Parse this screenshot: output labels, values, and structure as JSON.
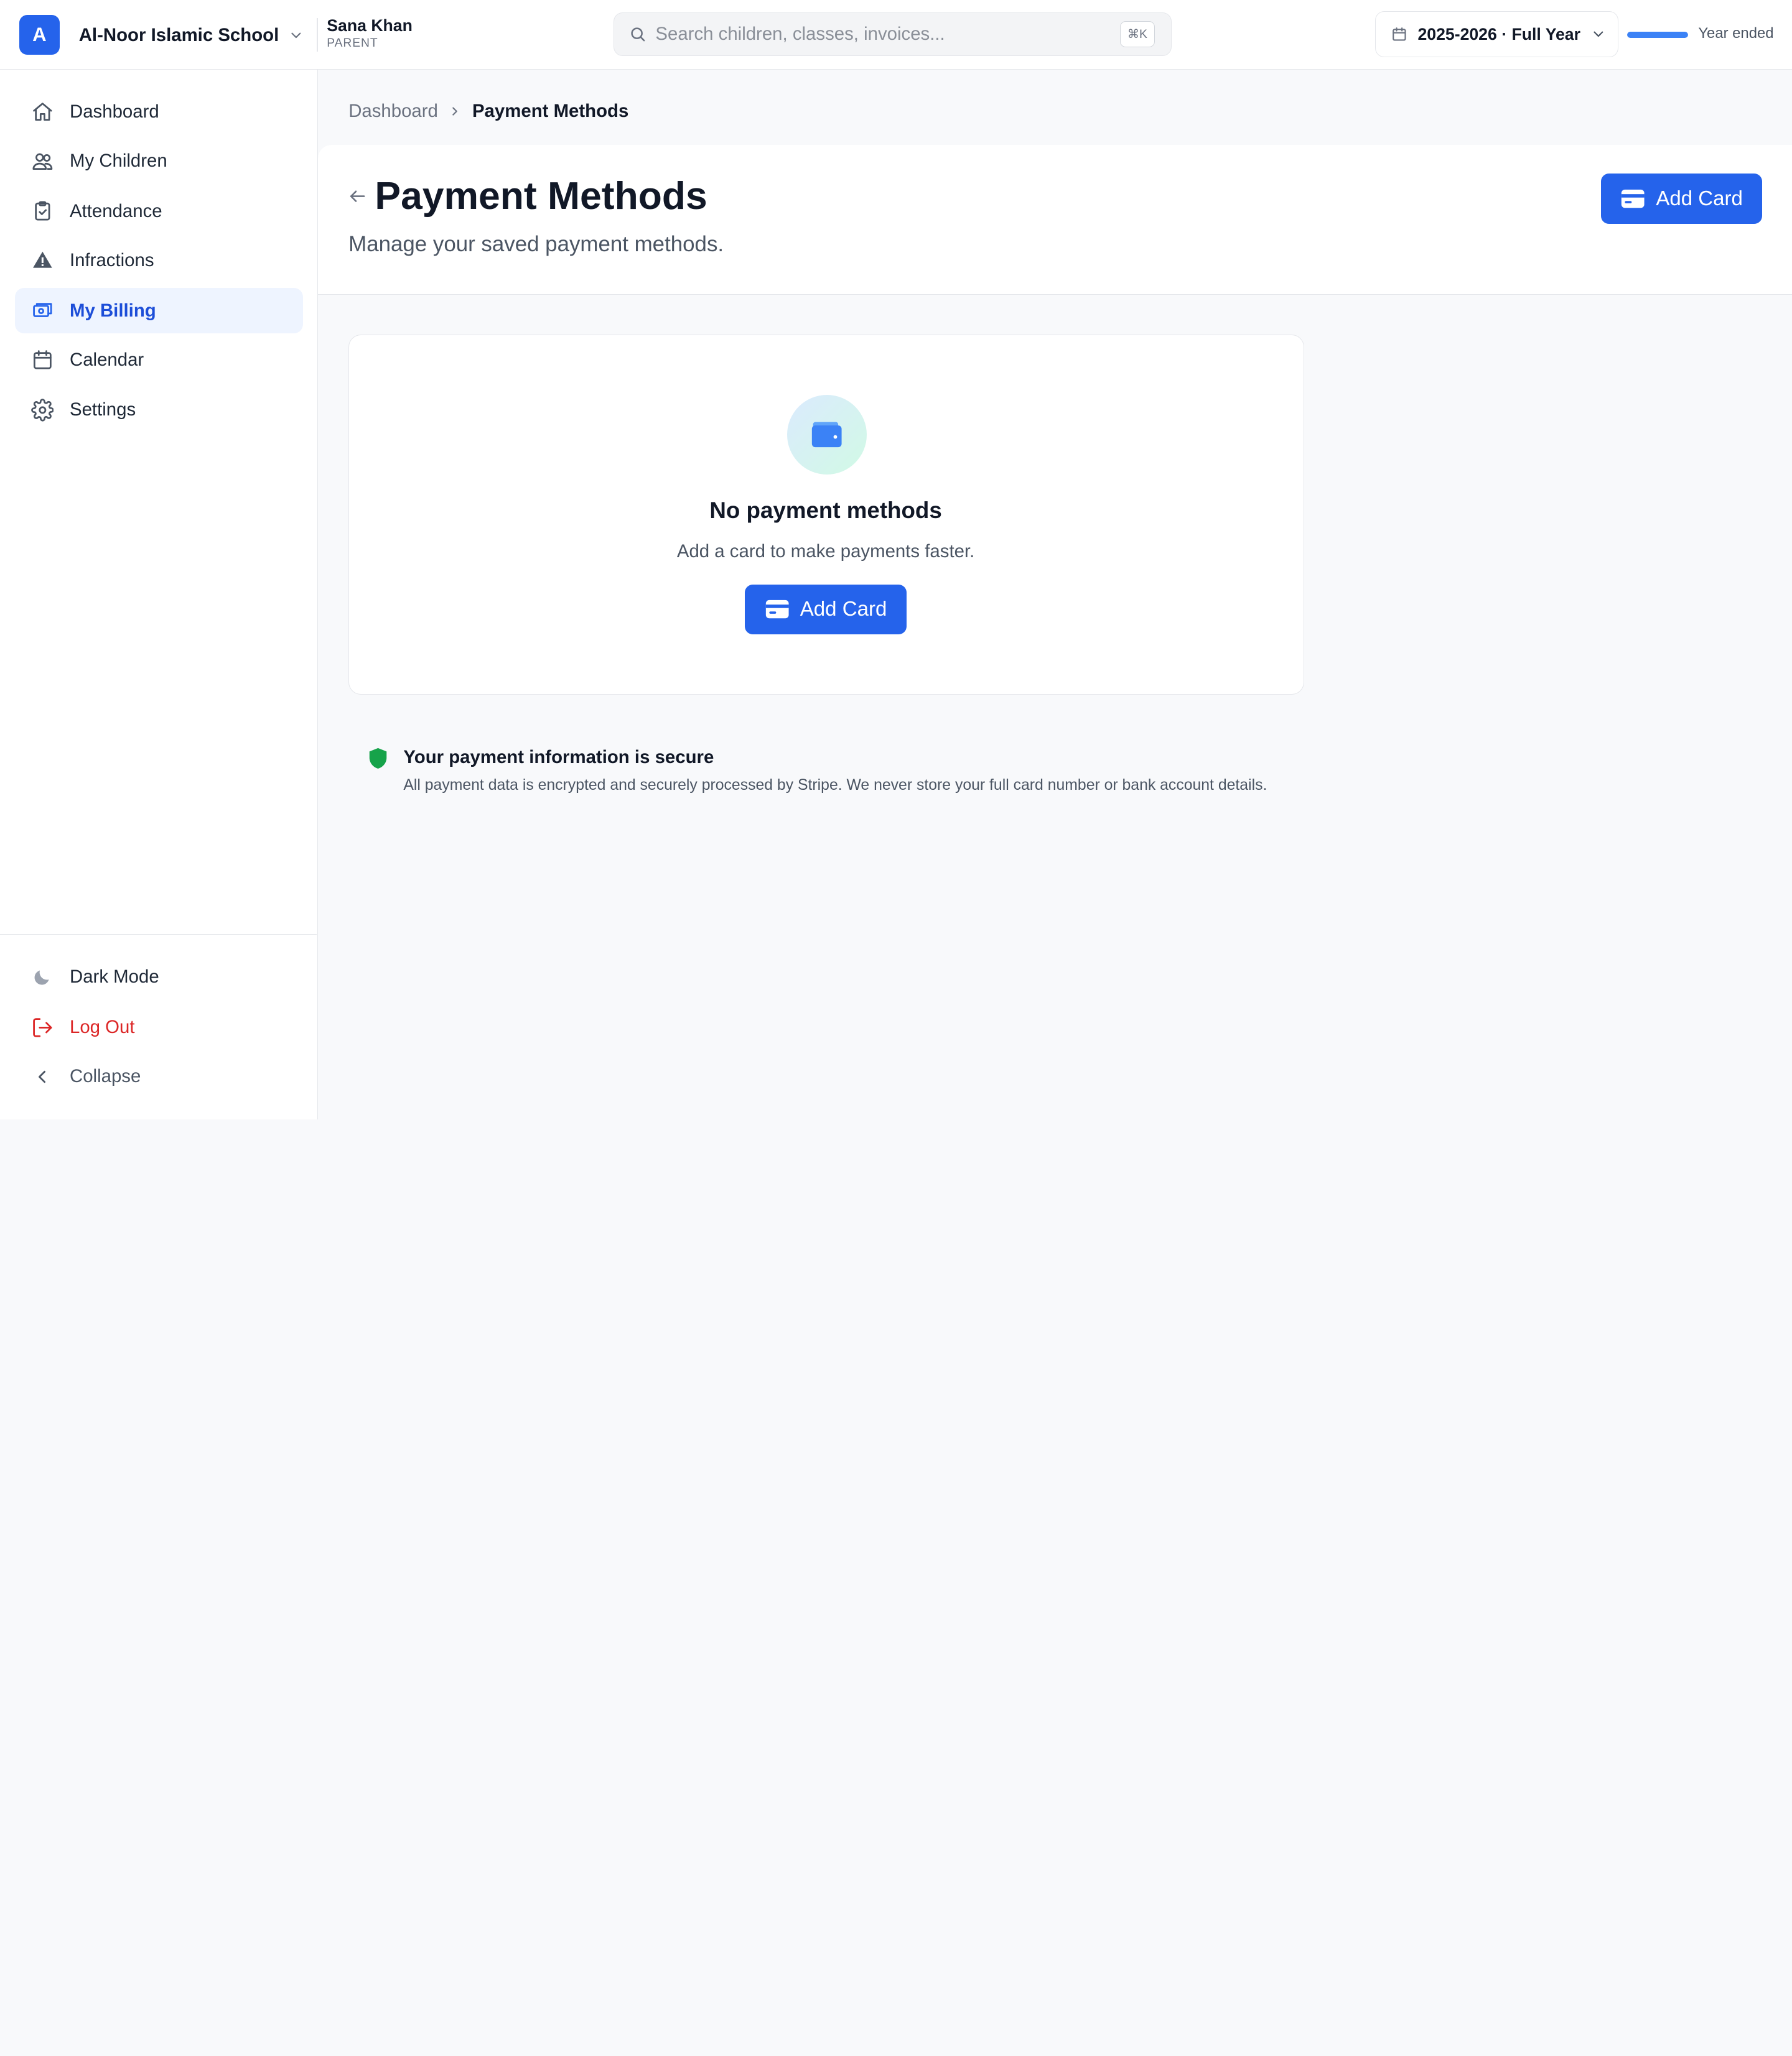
{
  "topbar": {
    "school_initial": "A",
    "school_name": "Al-Noor Islamic School",
    "user_name": "Sana Khan",
    "user_role": "PARENT",
    "search_placeholder": "Search children, classes, invoices...",
    "search_shortcut": "⌘K",
    "year_label": "2025-2026 · Full Year",
    "year_progress_percent": 100,
    "year_status": "Year ended"
  },
  "sidebar": {
    "items": [
      {
        "label": "Dashboard",
        "icon": "home-icon"
      },
      {
        "label": "My Children",
        "icon": "users-icon"
      },
      {
        "label": "Attendance",
        "icon": "clipboard-check-icon"
      },
      {
        "label": "Infractions",
        "icon": "warning-icon"
      },
      {
        "label": "My Billing",
        "icon": "billing-icon",
        "active": true
      },
      {
        "label": "Calendar",
        "icon": "calendar-icon"
      },
      {
        "label": "Settings",
        "icon": "gear-icon"
      }
    ],
    "bottom": {
      "dark_mode": "Dark Mode",
      "logout": "Log Out",
      "collapse": "Collapse"
    }
  },
  "breadcrumb": {
    "parent": "Dashboard",
    "current": "Payment Methods"
  },
  "header": {
    "title": "Payment Methods",
    "subtitle": "Manage your saved payment methods.",
    "add_card_label": "Add Card"
  },
  "empty_state": {
    "title": "No payment methods",
    "text": "Add a card to make payments faster.",
    "button_label": "Add Card"
  },
  "security": {
    "title": "Your payment information is secure",
    "description": "All payment data is encrypted and securely processed by Stripe. We never store your full card number or bank account details."
  },
  "colors": {
    "accent": "#2563eb",
    "active_bg": "#eef4ff",
    "danger": "#dc2626",
    "secure_green": "#16a34a"
  }
}
